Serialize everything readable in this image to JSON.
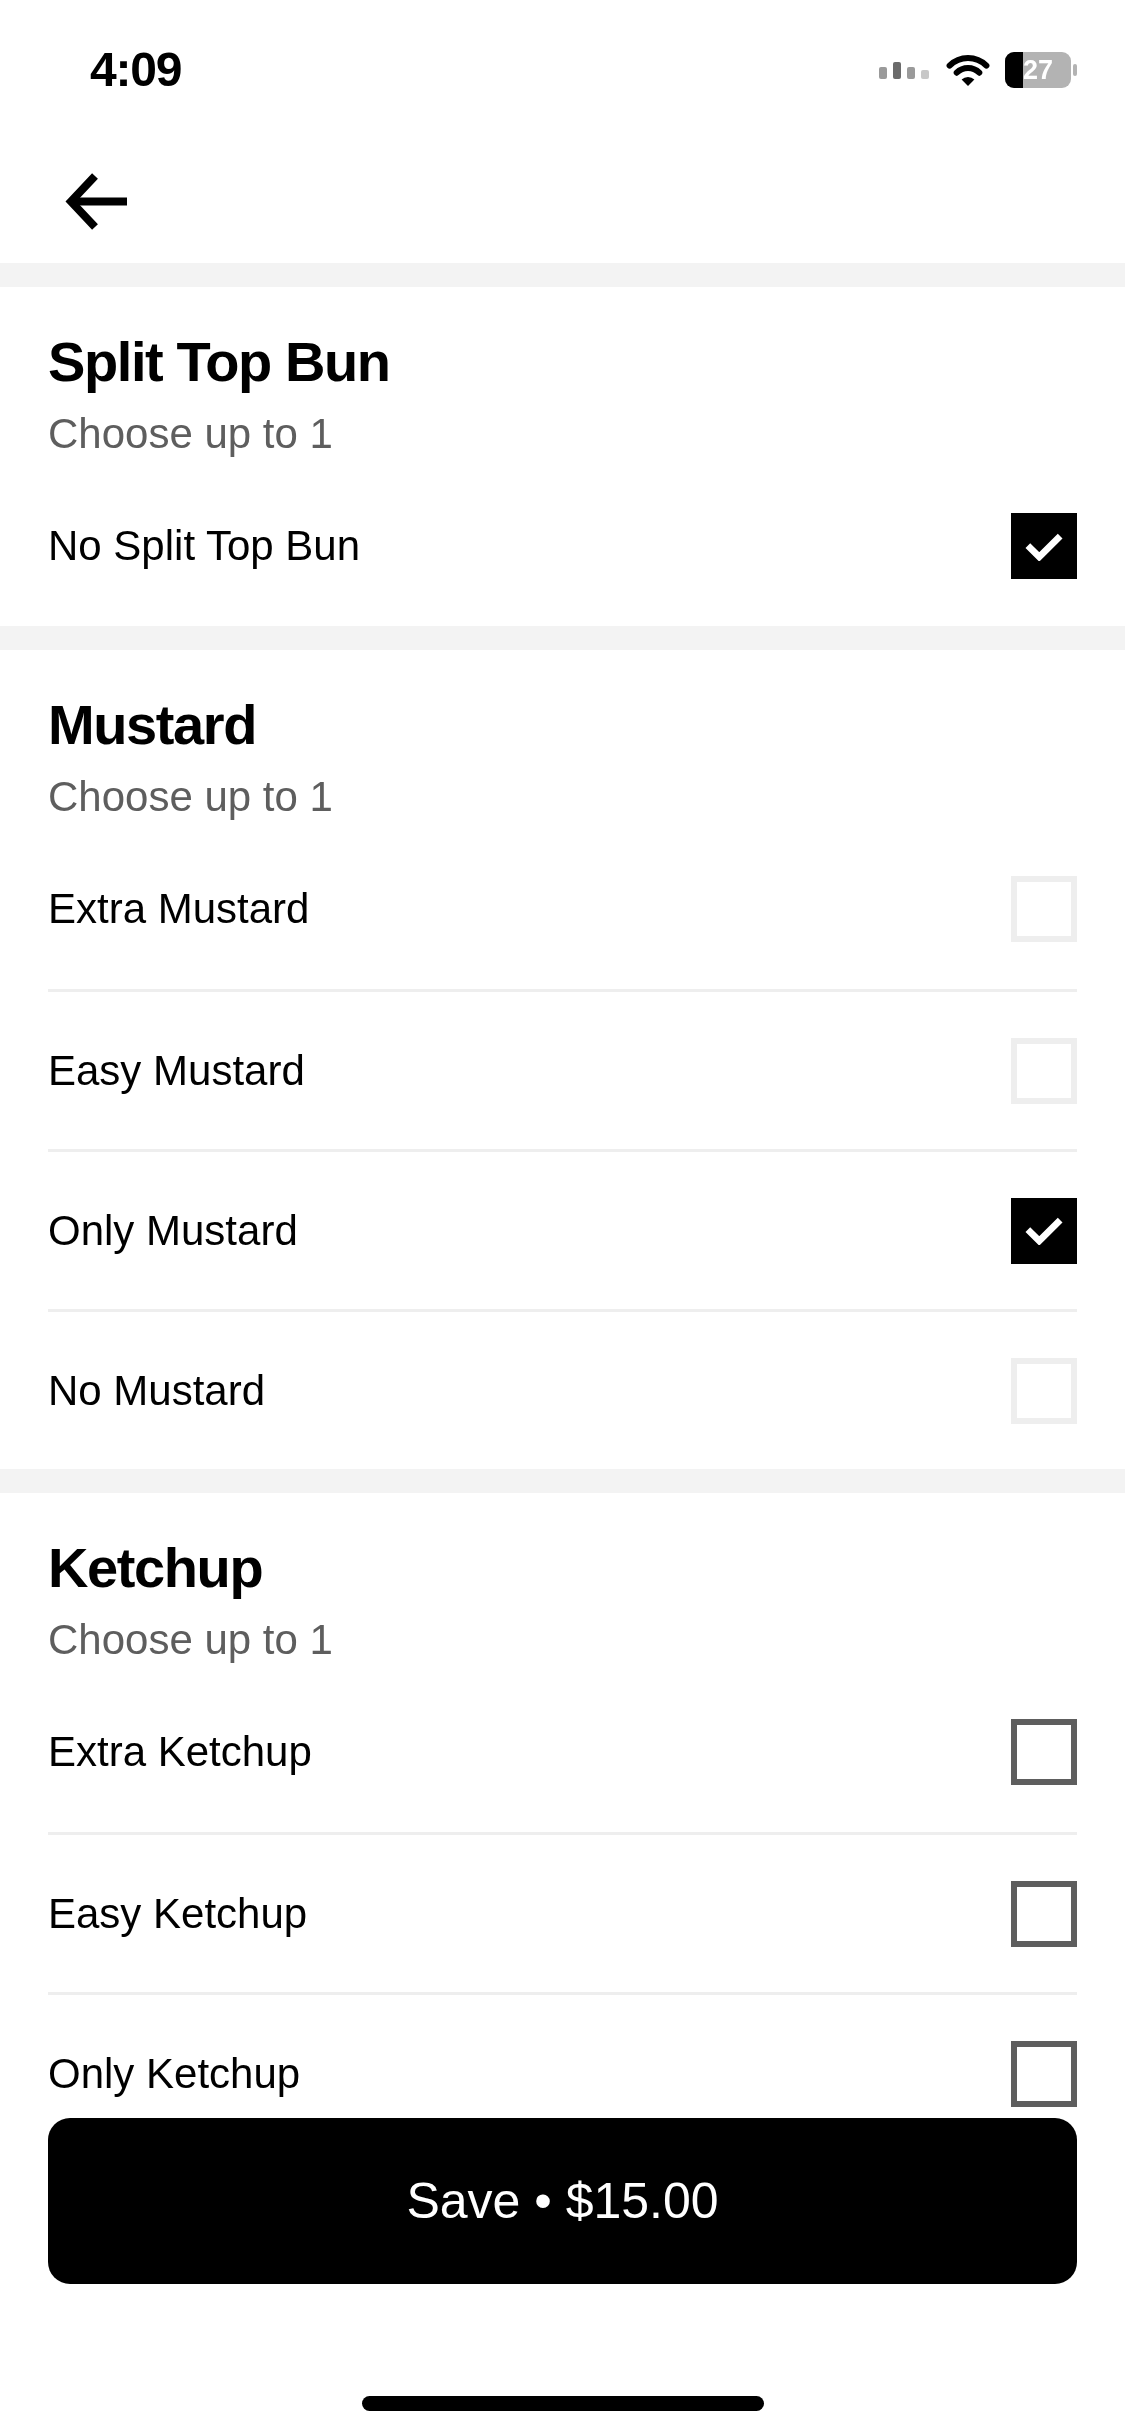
{
  "status_bar": {
    "time": "4:09",
    "battery": "27"
  },
  "groups": [
    {
      "title": "Split Top Bun",
      "subtitle": "Choose up to 1",
      "options": [
        {
          "label": "No Split Top Bun",
          "checked": true,
          "disabled": false
        }
      ]
    },
    {
      "title": "Mustard",
      "subtitle": "Choose up to 1",
      "options": [
        {
          "label": "Extra Mustard",
          "checked": false,
          "disabled": true
        },
        {
          "label": "Easy Mustard",
          "checked": false,
          "disabled": true
        },
        {
          "label": "Only Mustard",
          "checked": true,
          "disabled": false
        },
        {
          "label": "No Mustard",
          "checked": false,
          "disabled": true
        }
      ]
    },
    {
      "title": "Ketchup",
      "subtitle": "Choose up to 1",
      "options": [
        {
          "label": "Extra Ketchup",
          "checked": false,
          "disabled": false
        },
        {
          "label": "Easy Ketchup",
          "checked": false,
          "disabled": false
        },
        {
          "label": "Only Ketchup",
          "checked": false,
          "disabled": false
        }
      ]
    }
  ],
  "save_button": {
    "label": "Save • $15.00"
  }
}
